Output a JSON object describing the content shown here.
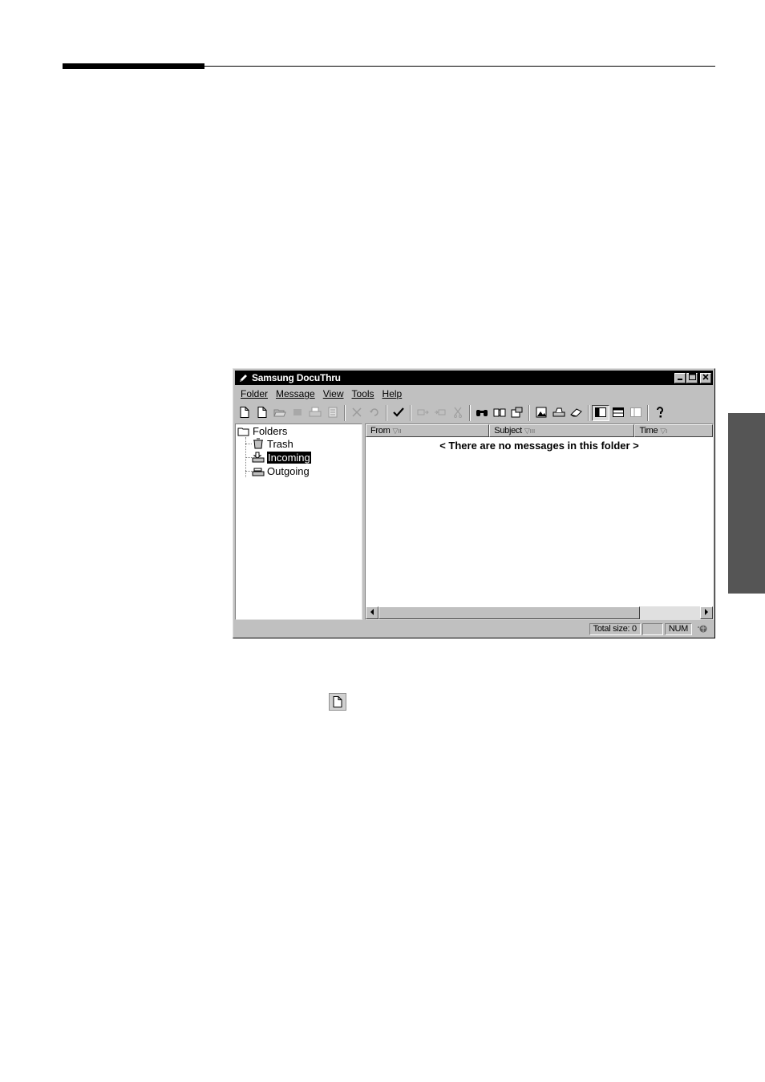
{
  "window": {
    "title": "Samsung DocuThru",
    "icons": {
      "app": "pencil-icon",
      "minimize": "minimize-icon",
      "maximize": "maximize-icon",
      "close": "close-icon"
    }
  },
  "menu": [
    "Folder",
    "Message",
    "View",
    "Tools",
    "Help"
  ],
  "toolbar": {
    "buttons": [
      "new-document-icon",
      "new-blank-icon",
      "open-folder-icon",
      "save-icon",
      "print-icon",
      "print-preview-icon",
      "delete-icon",
      "undo-icon",
      "check-icon",
      "reply-icon",
      "forward-icon",
      "cut-icon",
      "find-icon",
      "address-book-icon",
      "properties-icon",
      "image-icon",
      "scanner-icon",
      "eraser-icon",
      "layout-split-icon",
      "layout-preview-icon",
      "layout-list-icon",
      "help-icon"
    ]
  },
  "folders": {
    "root": "Folders",
    "items": [
      {
        "label": "Trash",
        "icon": "trash-icon"
      },
      {
        "label": "Incoming",
        "icon": "incoming-tray-icon",
        "selected": true
      },
      {
        "label": "Outgoing",
        "icon": "outgoing-tray-icon"
      }
    ]
  },
  "messages": {
    "columns": [
      "From",
      "Subject",
      "Time"
    ],
    "empty_text": "< There are no messages in this folder >"
  },
  "status": {
    "total_size": "Total size: 0",
    "num": "NUM"
  },
  "page": {
    "sidebar_tab_color": "#555555",
    "inline_icon": "new-document-icon"
  }
}
